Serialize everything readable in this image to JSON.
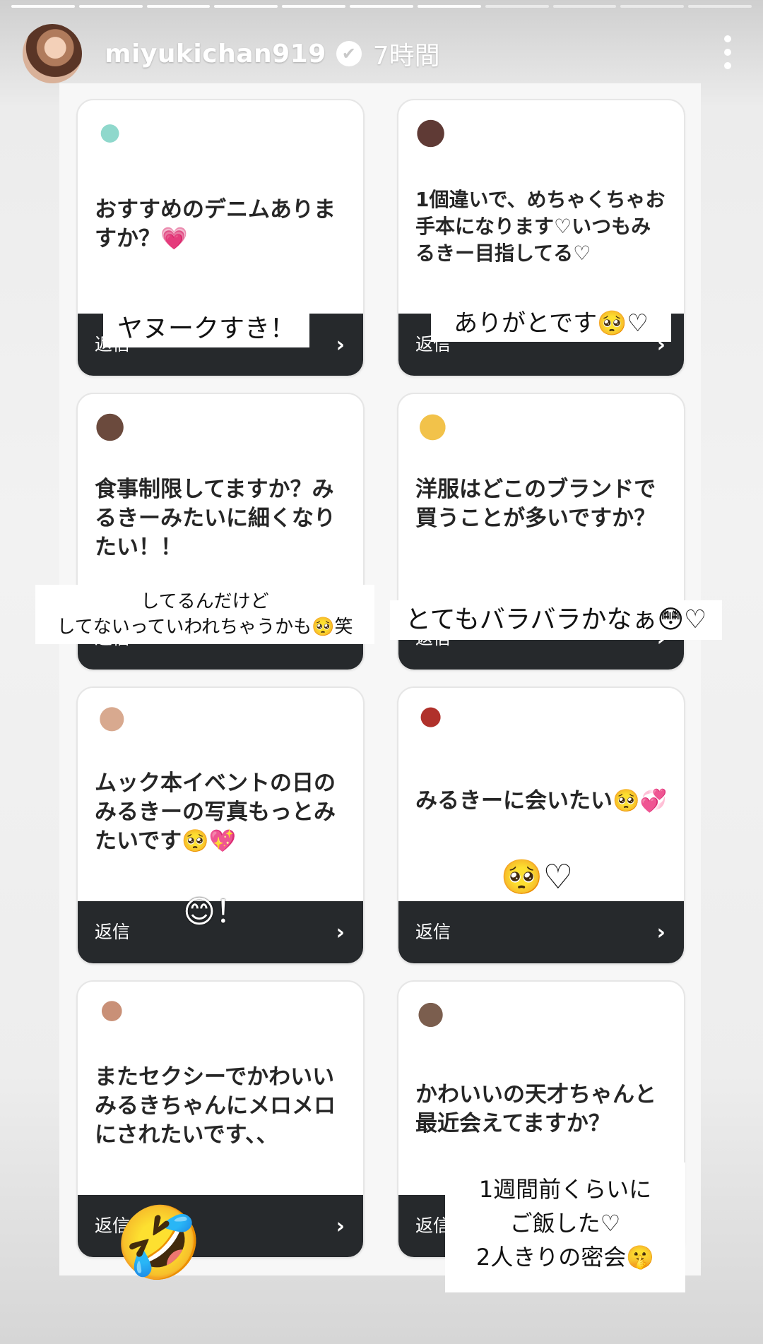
{
  "story": {
    "progress_segments": 11,
    "progress_active": 7,
    "username": "miyukichan919",
    "verified_icon": "verified-check-icon",
    "time": "7時間",
    "menu_icon": "more-vertical-icon"
  },
  "cards": [
    {
      "question": "おすすめのデニムありますか？💗",
      "reply_label": "返信",
      "answer": "ヤヌークすき！"
    },
    {
      "question": "1個違いで、めちゃくちゃお手本になります♡いつもみるきー目指してる♡",
      "reply_label": "返信",
      "answer": "ありがとです🥺♡"
    },
    {
      "question": "食事制限してますか？みるきーみたいに細くなりたい！！",
      "reply_label": "返信",
      "answer_line1": "してるんだけど",
      "answer_line2": "してないっていわれちゃうかも🥺笑"
    },
    {
      "question": "洋服はどこのブランドで買うことが多いですか？",
      "reply_label": "返信",
      "answer": "とてもバラバラかなぁ😳♡"
    },
    {
      "question": "ムック本イベントの日のみるきーの写真もっとみたいです🥺💖",
      "reply_label": "返信",
      "answer": "😊！"
    },
    {
      "question": "みるきーに会いたい🥺💞",
      "reply_label": "返信",
      "answer": "🥺♡"
    },
    {
      "question": "またセクシーでかわいいみるきちゃんにメロメロにされたいです、、",
      "reply_label": "返信",
      "answer": "🤣"
    },
    {
      "question": "かわいいの天才ちゃんと最近会えてますか？",
      "reply_label": "返信",
      "answer_line1": "1週間前くらいに",
      "answer_line2": "ご飯した♡",
      "answer_line3": "2人きりの密会🤫"
    }
  ],
  "colors": {
    "reply_bar": "#26292c",
    "question_text": "#262626",
    "sticker_bg": "#ffffff"
  }
}
